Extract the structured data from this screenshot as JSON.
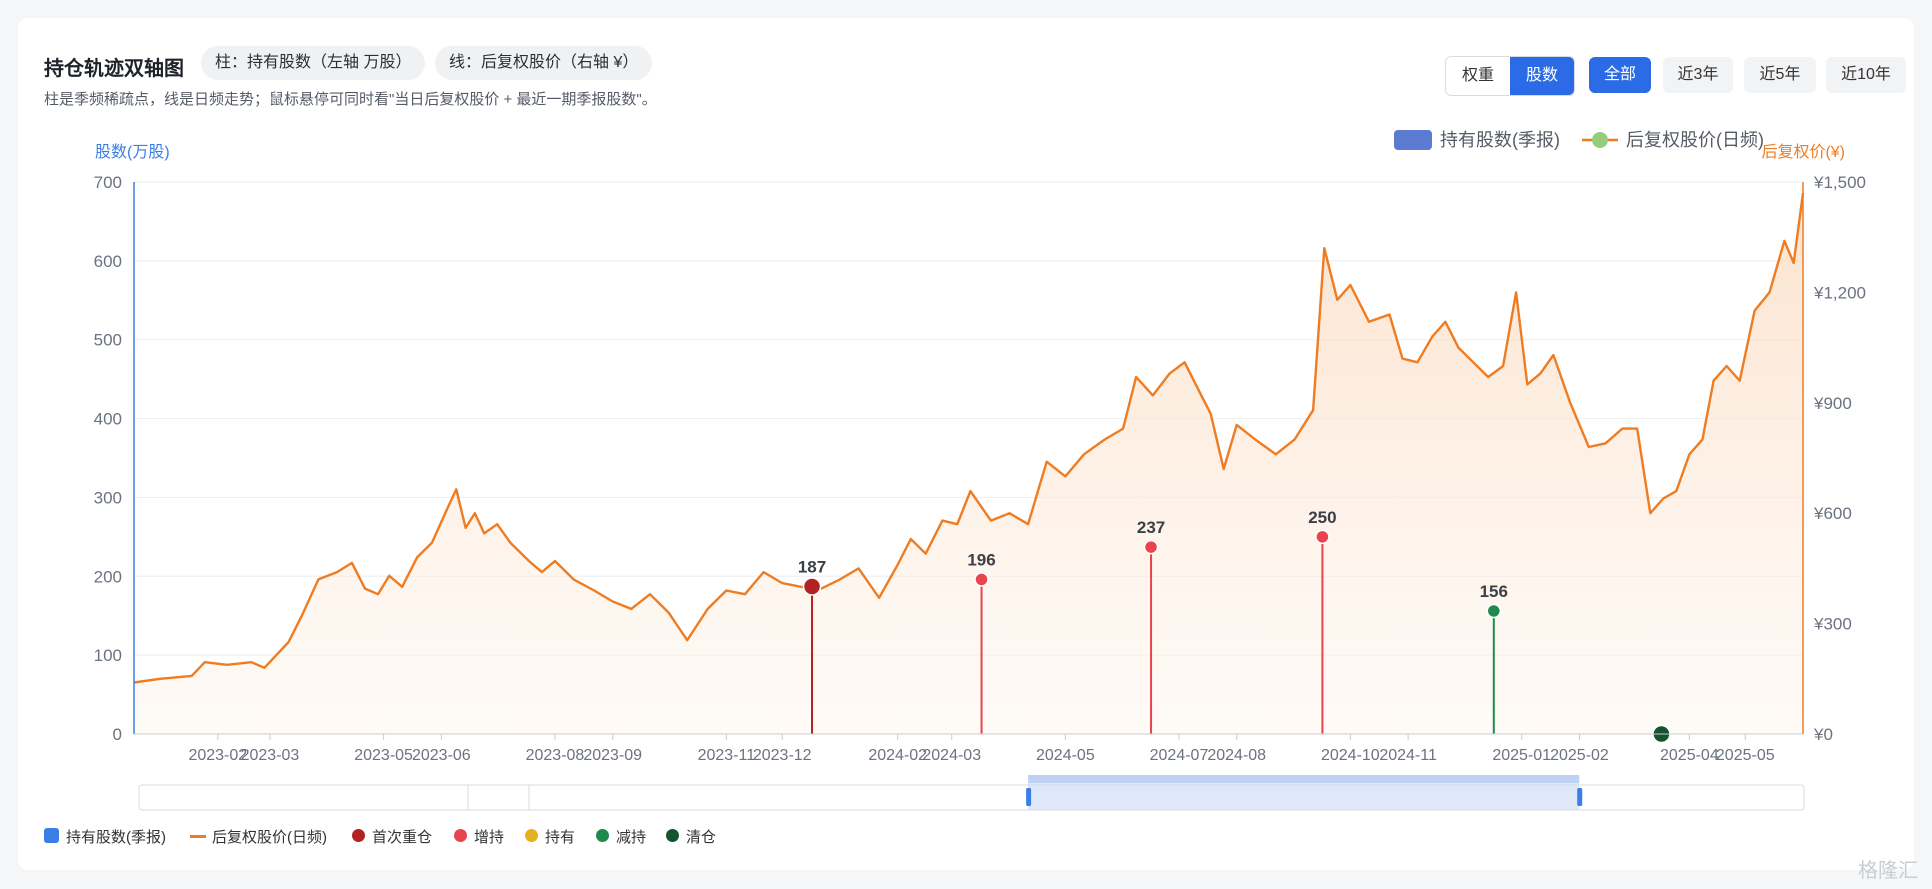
{
  "header": {
    "title": "持仓轨迹双轴图",
    "pill_bar": "柱：持有股数（左轴 万股）",
    "pill_line": "线：后复权股价（右轴 ¥）",
    "subtitle": "柱是季频稀疏点，线是日频走势；鼠标悬停可同时看\"当日后复权股价 + 最近一期季报股数\"。"
  },
  "controls": {
    "mode_weight": "权重",
    "mode_shares": "股数",
    "range_all": "全部",
    "range_3y": "近3年",
    "range_5y": "近5年",
    "range_10y": "近10年"
  },
  "legend_bottom": {
    "bar": "持有股数(季报)",
    "line": "后复权股价(日频)",
    "first": "首次重仓",
    "add": "增持",
    "hold": "持有",
    "reduce": "减持",
    "clear": "清仓"
  },
  "watermark": "格隆汇",
  "chart_data": {
    "type": "bar+line",
    "legend": [
      "持有股数(季报)",
      "后复权股价(日频)"
    ],
    "legend_position": "top-right",
    "left_axis": {
      "label": "股数(万股)",
      "range": [
        0,
        700
      ],
      "ticks": [
        "0",
        "100",
        "200",
        "300",
        "400",
        "500",
        "600",
        "700"
      ]
    },
    "right_axis": {
      "label": "后复权价(¥)",
      "range": [
        0,
        1500
      ],
      "ticks": [
        "¥0",
        "¥300",
        "¥600",
        "¥900",
        "¥1,200",
        "¥1,500"
      ]
    },
    "x_ticks": [
      "2023-02",
      "2023-03",
      "2023-05",
      "2023-06",
      "2023-08",
      "2023-09",
      "2023-11",
      "2023-12",
      "2024-02",
      "2024-03",
      "2024-05",
      "2024-07",
      "2024-08",
      "2024-10",
      "2024-11",
      "2025-01",
      "2025-02",
      "2025-04",
      "2025-05"
    ],
    "x_range": [
      "2023-01-01",
      "2025-06-15"
    ],
    "grid": true,
    "holdings": [
      {
        "date": "2023-12-31",
        "shares": 187,
        "label": "187",
        "action": "首次重仓"
      },
      {
        "date": "2024-03-31",
        "shares": 196,
        "label": "196",
        "action": "增持"
      },
      {
        "date": "2024-06-30",
        "shares": 237,
        "label": "237",
        "action": "增持"
      },
      {
        "date": "2024-09-30",
        "shares": 250,
        "label": "250",
        "action": "增持"
      },
      {
        "date": "2024-12-31",
        "shares": 156,
        "label": "156",
        "action": "减持"
      },
      {
        "date": "2025-03-31",
        "shares": 0,
        "label": "",
        "action": "清仓"
      }
    ],
    "price_series": {
      "name": "后复权股价(日频)",
      "points": [
        [
          "2023-01-01",
          140
        ],
        [
          "2023-01-15",
          150
        ],
        [
          "2023-02-01",
          158
        ],
        [
          "2023-02-08",
          195
        ],
        [
          "2023-02-20",
          188
        ],
        [
          "2023-03-05",
          195
        ],
        [
          "2023-03-12",
          180
        ],
        [
          "2023-03-25",
          250
        ],
        [
          "2023-04-01",
          320
        ],
        [
          "2023-04-10",
          420
        ],
        [
          "2023-04-20",
          440
        ],
        [
          "2023-04-28",
          465
        ],
        [
          "2023-05-05",
          395
        ],
        [
          "2023-05-12",
          380
        ],
        [
          "2023-05-18",
          430
        ],
        [
          "2023-05-25",
          400
        ],
        [
          "2023-06-02",
          480
        ],
        [
          "2023-06-10",
          520
        ],
        [
          "2023-06-18",
          610
        ],
        [
          "2023-06-23",
          665
        ],
        [
          "2023-06-28",
          560
        ],
        [
          "2023-07-03",
          600
        ],
        [
          "2023-07-08",
          545
        ],
        [
          "2023-07-15",
          570
        ],
        [
          "2023-07-22",
          520
        ],
        [
          "2023-08-01",
          470
        ],
        [
          "2023-08-08",
          440
        ],
        [
          "2023-08-15",
          470
        ],
        [
          "2023-08-25",
          420
        ],
        [
          "2023-09-05",
          390
        ],
        [
          "2023-09-15",
          360
        ],
        [
          "2023-09-25",
          340
        ],
        [
          "2023-10-05",
          380
        ],
        [
          "2023-10-15",
          330
        ],
        [
          "2023-10-25",
          255
        ],
        [
          "2023-11-05",
          340
        ],
        [
          "2023-11-15",
          390
        ],
        [
          "2023-11-25",
          380
        ],
        [
          "2023-12-05",
          440
        ],
        [
          "2023-12-15",
          410
        ],
        [
          "2023-12-25",
          400
        ],
        [
          "2024-01-05",
          395
        ],
        [
          "2024-01-15",
          420
        ],
        [
          "2024-01-25",
          450
        ],
        [
          "2024-02-05",
          370
        ],
        [
          "2024-02-15",
          460
        ],
        [
          "2024-02-22",
          530
        ],
        [
          "2024-03-01",
          490
        ],
        [
          "2024-03-10",
          580
        ],
        [
          "2024-03-18",
          570
        ],
        [
          "2024-03-25",
          660
        ],
        [
          "2024-04-05",
          580
        ],
        [
          "2024-04-15",
          600
        ],
        [
          "2024-04-25",
          570
        ],
        [
          "2024-05-05",
          740
        ],
        [
          "2024-05-15",
          700
        ],
        [
          "2024-05-25",
          760
        ],
        [
          "2024-06-05",
          800
        ],
        [
          "2024-06-15",
          830
        ],
        [
          "2024-06-22",
          970
        ],
        [
          "2024-07-01",
          920
        ],
        [
          "2024-07-10",
          980
        ],
        [
          "2024-07-18",
          1010
        ],
        [
          "2024-07-25",
          940
        ],
        [
          "2024-08-01",
          870
        ],
        [
          "2024-08-08",
          720
        ],
        [
          "2024-08-15",
          840
        ],
        [
          "2024-08-25",
          800
        ],
        [
          "2024-09-05",
          760
        ],
        [
          "2024-09-15",
          800
        ],
        [
          "2024-09-25",
          880
        ],
        [
          "2024-10-01",
          1320
        ],
        [
          "2024-10-08",
          1180
        ],
        [
          "2024-10-15",
          1220
        ],
        [
          "2024-10-25",
          1120
        ],
        [
          "2024-11-05",
          1140
        ],
        [
          "2024-11-12",
          1020
        ],
        [
          "2024-11-20",
          1010
        ],
        [
          "2024-11-28",
          1080
        ],
        [
          "2024-12-05",
          1120
        ],
        [
          "2024-12-12",
          1050
        ],
        [
          "2024-12-20",
          1010
        ],
        [
          "2024-12-28",
          970
        ],
        [
          "2025-01-05",
          1000
        ],
        [
          "2025-01-12",
          1200
        ],
        [
          "2025-01-18",
          950
        ],
        [
          "2025-01-25",
          980
        ],
        [
          "2025-02-01",
          1030
        ],
        [
          "2025-02-10",
          900
        ],
        [
          "2025-02-20",
          780
        ],
        [
          "2025-03-01",
          790
        ],
        [
          "2025-03-10",
          830
        ],
        [
          "2025-03-18",
          830
        ],
        [
          "2025-03-25",
          600
        ],
        [
          "2025-04-01",
          640
        ],
        [
          "2025-04-08",
          660
        ],
        [
          "2025-04-15",
          760
        ],
        [
          "2025-04-22",
          800
        ],
        [
          "2025-04-28",
          960
        ],
        [
          "2025-05-05",
          1000
        ],
        [
          "2025-05-12",
          960
        ],
        [
          "2025-05-20",
          1150
        ],
        [
          "2025-05-28",
          1200
        ],
        [
          "2025-06-05",
          1340
        ],
        [
          "2025-06-10",
          1280
        ],
        [
          "2025-06-15",
          1470
        ]
      ]
    },
    "data_zoom": {
      "start": 0.534,
      "end": 0.865
    }
  }
}
